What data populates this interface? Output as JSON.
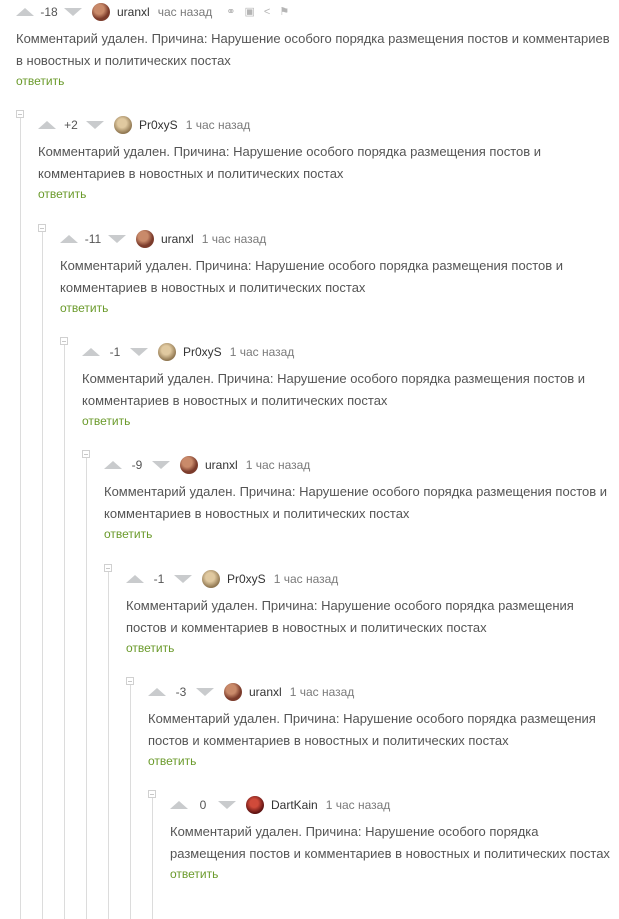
{
  "comments": [
    {
      "rating": "-18",
      "user": "uranxl",
      "time": "час назад",
      "avatar": "#7b3b2b",
      "body": "Комментарий удален. Причина: Нарушение особого порядка размещения постов и комментариев в новостных и политических постах",
      "reply": "ответить"
    },
    {
      "rating": "+2",
      "user": "Pr0xyS",
      "time": "1 час назад",
      "avatar": "#b79a6c",
      "body": "Комментарий удален. Причина: Нарушение особого порядка размещения постов и комментариев в новостных и политических постах",
      "reply": "ответить"
    },
    {
      "rating": "-11",
      "user": "uranxl",
      "time": "1 час назад",
      "avatar": "#7b3b2b",
      "body": "Комментарий удален. Причина: Нарушение особого порядка размещения постов и комментариев в новостных и политических постах",
      "reply": "ответить"
    },
    {
      "rating": "-1",
      "user": "Pr0xyS",
      "time": "1 час назад",
      "avatar": "#b79a6c",
      "body": "Комментарий удален. Причина: Нарушение особого порядка размещения постов и комментариев в новостных и политических постах",
      "reply": "ответить"
    },
    {
      "rating": "-9",
      "user": "uranxl",
      "time": "1 час назад",
      "avatar": "#7b3b2b",
      "body": "Комментарий удален. Причина: Нарушение особого порядка размещения постов и комментариев в новостных и политических постах",
      "reply": "ответить"
    },
    {
      "rating": "-1",
      "user": "Pr0xyS",
      "time": "1 час назад",
      "avatar": "#b79a6c",
      "body": "Комментарий удален. Причина: Нарушение особого порядка размещения постов и комментариев в новостных и политических постах",
      "reply": "ответить"
    },
    {
      "rating": "-3",
      "user": "uranxl",
      "time": "1 час назад",
      "avatar": "#7b3b2b",
      "body": "Комментарий удален. Причина: Нарушение особого порядка размещения постов и комментариев в новостных и политических постах",
      "reply": "ответить"
    },
    {
      "rating": "0",
      "user": "DartKain",
      "time": "1 час назад",
      "avatar": "#8a1e1e",
      "body": "Комментарий удален. Причина: Нарушение особого порядка размещения постов и комментариев в новостных и политических постах",
      "reply": "ответить"
    }
  ],
  "tools": [
    {
      "icon": "link-icon",
      "glyph": "⚭"
    },
    {
      "icon": "save-icon",
      "glyph": "▣"
    },
    {
      "icon": "share-icon",
      "glyph": "<"
    },
    {
      "icon": "flag-icon",
      "glyph": "⚑"
    }
  ],
  "colors": {
    "reply_link": "#6a9a2a",
    "arrow": "#c9cbcd",
    "thread_line": "#dcdcdc"
  }
}
